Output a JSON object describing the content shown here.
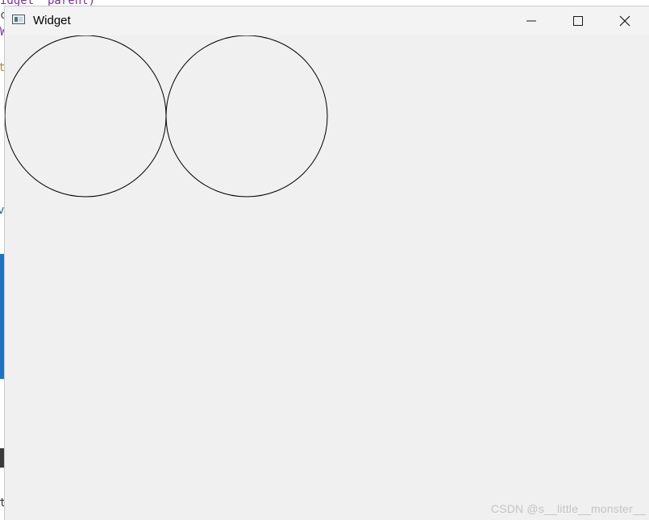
{
  "background": {
    "code_fragments": [
      {
        "text": "idget  parent)",
        "color": "#7b2fa0"
      },
      {
        "text": "c",
        "color": "#444444"
      },
      {
        "text": "W",
        "color": "#7b2fa0"
      },
      {
        "text": "t",
        "color": "#b08a1a"
      },
      {
        "text": "v",
        "color": "#1d6f8a"
      },
      {
        "text": "t",
        "color": "#333333"
      }
    ]
  },
  "window": {
    "title": "Widget",
    "icon": "app-window-icon",
    "controls": {
      "minimize_icon": "minimize-icon",
      "maximize_icon": "maximize-icon",
      "close_icon": "close-icon"
    }
  },
  "canvas": {
    "shapes": [
      {
        "type": "circle",
        "stroke": "#000000",
        "fill": "none"
      },
      {
        "type": "circle",
        "stroke": "#000000",
        "fill": "none"
      }
    ]
  },
  "watermark": "CSDN @s__little__monster__",
  "colors": {
    "window_bg": "#f0f0f0",
    "titlebar_bg": "#f3f3f3",
    "watermark": "#c4c4c4"
  }
}
